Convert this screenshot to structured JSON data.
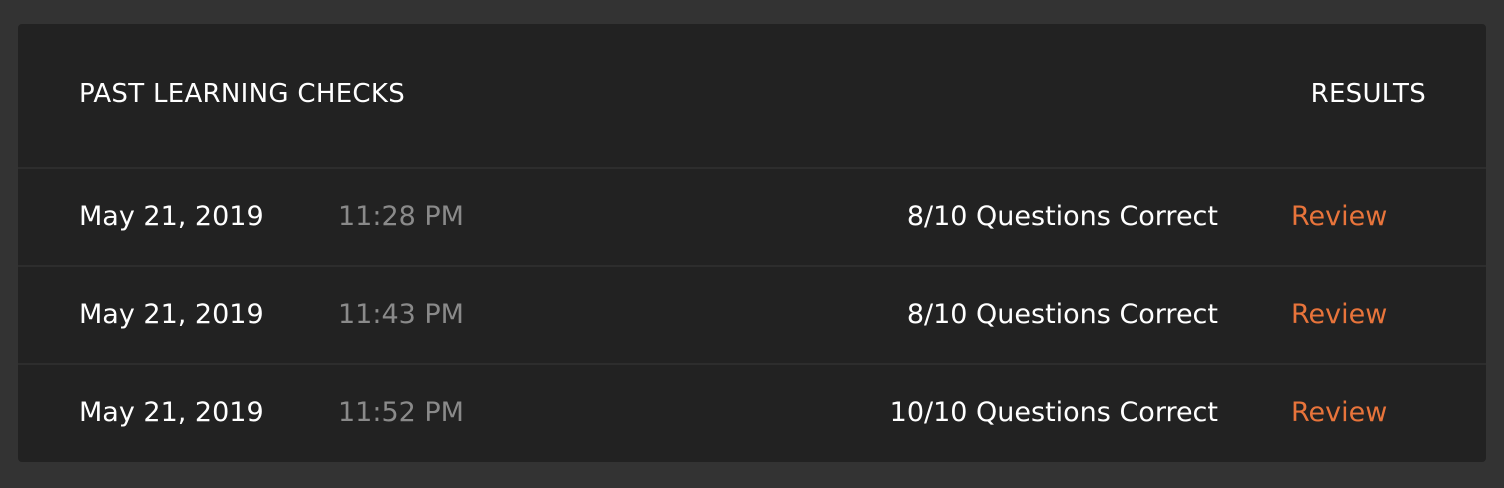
{
  "panel": {
    "title": "PAST LEARNING CHECKS",
    "results_label": "RESULTS"
  },
  "rows": [
    {
      "date": "May 21, 2019",
      "time": "11:28 PM",
      "score": "8/10 Questions Correct",
      "action": "Review"
    },
    {
      "date": "May 21, 2019",
      "time": "11:43 PM",
      "score": "8/10 Questions Correct",
      "action": "Review"
    },
    {
      "date": "May 21, 2019",
      "time": "11:52 PM",
      "score": "10/10 Questions Correct",
      "action": "Review"
    }
  ],
  "colors": {
    "background": "#333333",
    "panel": "#222222",
    "accent": "#e8743b",
    "muted_text": "#8a8a8a"
  }
}
